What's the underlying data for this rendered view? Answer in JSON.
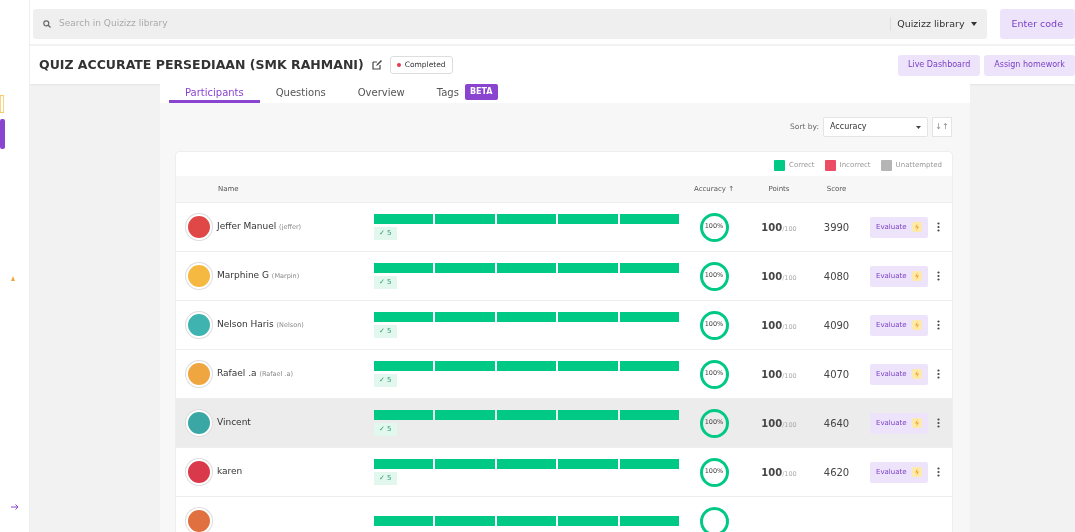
{
  "search": {
    "placeholder": "Search in Quizizz library",
    "scope": "Quizizz library"
  },
  "enter_code": "Enter code",
  "quiz": {
    "title": "QUIZ ACCURATE PERSEDIAAN (SMK RAHMANI)",
    "status": "Completed"
  },
  "header_buttons": [
    "Live Dashboard",
    "Assign homework"
  ],
  "tabs": [
    {
      "label": "Participants",
      "selected": true
    },
    {
      "label": "Questions",
      "selected": false
    },
    {
      "label": "Overview",
      "selected": false
    },
    {
      "label": "Tags",
      "selected": false,
      "badge": "BETA"
    }
  ],
  "sort": {
    "label": "Sort by:",
    "value": "Accuracy",
    "order_icon": "↓↑"
  },
  "legend": [
    {
      "label": "Correct",
      "color": "#00c985"
    },
    {
      "label": "Incorrect",
      "color": "#ec4d64"
    },
    {
      "label": "Unattempted",
      "color": "#b5b5b5"
    }
  ],
  "columns": {
    "name": "Name",
    "accuracy": "Accuracy ↑",
    "points": "Points",
    "score": "Score"
  },
  "participants": [
    {
      "name": "Jeffer Manuel",
      "username": "(jeffer)",
      "color": "#e04848",
      "answers": [
        {
          "correct": true
        },
        {
          "correct": true
        },
        {
          "correct": true
        },
        {
          "correct": true
        },
        {
          "correct": true
        }
      ],
      "correct_count": "✓ 5",
      "accuracy": "100%",
      "points": "100",
      "points_max": "/100",
      "score": "3990",
      "action": "Evaluate",
      "hovered": false
    },
    {
      "name": "Marphine G",
      "username": "(Marpin)",
      "color": "#f5b942",
      "answers": [
        {
          "correct": true
        },
        {
          "correct": true
        },
        {
          "correct": true
        },
        {
          "correct": true
        },
        {
          "correct": true
        }
      ],
      "correct_count": "✓ 5",
      "accuracy": "100%",
      "points": "100",
      "points_max": "/100",
      "score": "4080",
      "action": "Evaluate",
      "hovered": false
    },
    {
      "name": "Nelson Haris",
      "username": "(Nelson)",
      "color": "#3fb3b0",
      "answers": [
        {
          "correct": true
        },
        {
          "correct": true
        },
        {
          "correct": true
        },
        {
          "correct": true
        },
        {
          "correct": true
        }
      ],
      "correct_count": "✓ 5",
      "accuracy": "100%",
      "points": "100",
      "points_max": "/100",
      "score": "4090",
      "action": "Evaluate",
      "hovered": false
    },
    {
      "name": "Rafael .a",
      "username": "(Rafael .a)",
      "color": "#f0a640",
      "answers": [
        {
          "correct": true
        },
        {
          "correct": true
        },
        {
          "correct": true
        },
        {
          "correct": true
        },
        {
          "correct": true
        }
      ],
      "correct_count": "✓ 5",
      "accuracy": "100%",
      "points": "100",
      "points_max": "/100",
      "score": "4070",
      "action": "Evaluate",
      "hovered": false
    },
    {
      "name": "Vincent",
      "color": "#3aa7a5",
      "answers": [
        {
          "correct": true
        },
        {
          "correct": true
        },
        {
          "correct": true
        },
        {
          "correct": true
        },
        {
          "correct": true
        }
      ],
      "correct_count": "✓ 5",
      "accuracy": "100%",
      "points": "100",
      "points_max": "/100",
      "score": "4640",
      "action": "Evaluate",
      "hovered": true
    },
    {
      "name": "karen",
      "color": "#d9394a",
      "answers": [
        {
          "correct": true
        },
        {
          "correct": true
        },
        {
          "correct": true
        },
        {
          "correct": true
        },
        {
          "correct": true
        }
      ],
      "correct_count": "✓ 5",
      "accuracy": "100%",
      "points": "100",
      "points_max": "/100",
      "score": "4620",
      "action": "Evaluate",
      "hovered": false
    },
    {
      "color": "#e07040",
      "answers": [
        {
          "correct": true
        },
        {
          "correct": true
        },
        {
          "correct": true
        },
        {
          "correct": true
        },
        {
          "correct": true
        }
      ],
      "hovered": false
    }
  ]
}
